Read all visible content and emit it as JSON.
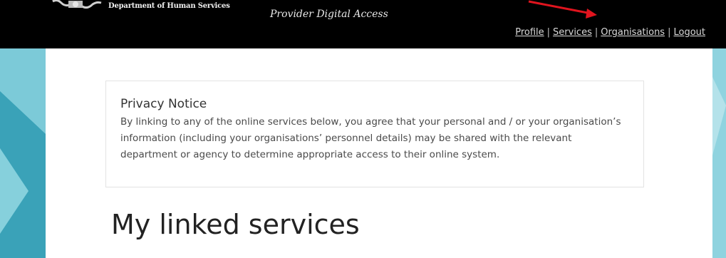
{
  "header": {
    "department": "Department of Human Services",
    "app_title": "Provider Digital Access",
    "nav": [
      {
        "label": "Profile"
      },
      {
        "label": "Services"
      },
      {
        "label": "Organisations"
      },
      {
        "label": "Logout"
      }
    ]
  },
  "privacy": {
    "title": "Privacy Notice",
    "text": "By linking to any of the online services below, you agree that your personal and / or your organisation’s information (including your organisations’ personnel details) may be shared with the relevant department or agency to determine appropriate access to their online system."
  },
  "main": {
    "heading": "My linked services"
  },
  "colors": {
    "header_bg": "#000000",
    "background_teal": "#5bb8c9",
    "annotation_arrow": "#e0141e"
  }
}
